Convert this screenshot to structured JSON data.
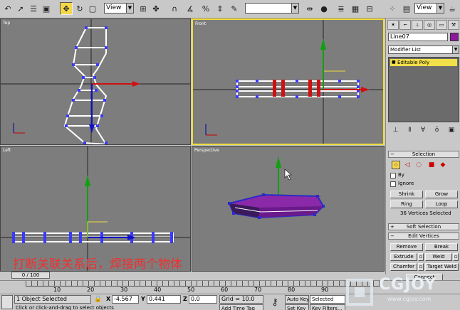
{
  "toolbar": {
    "view_dropdown_1": "View",
    "view_dropdown_2": "View",
    "selection_set_dropdown": ""
  },
  "viewports": {
    "top": {
      "label": "Top"
    },
    "front": {
      "label": "Front"
    },
    "left": {
      "label": "Left"
    },
    "perspective": {
      "label": "Perspective"
    }
  },
  "command_panel": {
    "object_name": "Line07",
    "object_color": "#8c1a9a",
    "modifier_list": "Modifier List",
    "stack_items": [
      "Editable Poly"
    ],
    "selection_rollout": {
      "title": "Selection",
      "by_label": "By",
      "ignore_label": "Ignore",
      "shrink": "Shrink",
      "grow": "Grow",
      "ring": "Ring",
      "loop": "Loop",
      "status": "36 Vertices Selected"
    },
    "soft_selection_rollout": {
      "title": "Soft Selection"
    },
    "edit_vertices_rollout": {
      "title": "Edit Vertices",
      "remove": "Remove",
      "break": "Break",
      "extrude": "Extrude",
      "weld": "Weld",
      "chamfer": "Chamfer",
      "target_weld": "Target Weld",
      "connect": "Connect"
    }
  },
  "time_slider": {
    "label": "0 / 100"
  },
  "track_bar": {
    "ticks": [
      "10",
      "20",
      "30",
      "40",
      "50",
      "60",
      "70",
      "80",
      "90"
    ]
  },
  "status_bar": {
    "objects_selected": "1 Object Selected",
    "prompt": "Click or click-and-drag to select objects",
    "x_label": "X",
    "x_value": "-4.567",
    "y_label": "Y",
    "y_value": "0.441",
    "z_label": "Z",
    "z_value": "0.0",
    "grid": "Grid = 10.0",
    "add_time_tag": "Add Time Tag",
    "auto_key": "Auto Key",
    "set_key": "Set Key",
    "selected": "Selected",
    "key_filters": "Key Filters..."
  },
  "caption": "打断关联关系后，焊接两个物体",
  "watermark": {
    "brand": "CGJOY",
    "url": "www.cgjoy.com"
  }
}
